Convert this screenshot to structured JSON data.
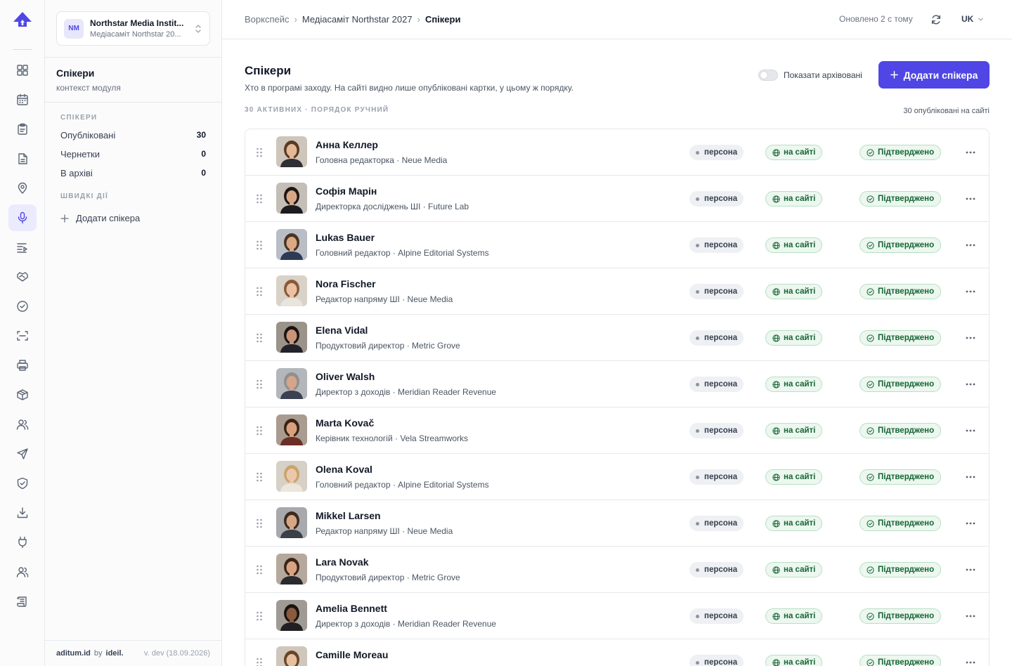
{
  "rail": {
    "icons": [
      "dashboard-icon",
      "calendar-icon",
      "clipboard-icon",
      "document-icon",
      "location-icon",
      "microphone-icon",
      "agenda-icon",
      "handshake-icon",
      "check-circle-icon",
      "scan-icon",
      "printer-icon",
      "package-icon",
      "users-icon",
      "send-icon",
      "shield-icon",
      "download-icon",
      "plug-icon",
      "team-icon",
      "scroll-icon"
    ],
    "active": "microphone-icon"
  },
  "workspace": {
    "badge": "NM",
    "name": "Northstar Media Instit...",
    "sub": "Медіасаміт Northstar 20..."
  },
  "module": {
    "title": "Спікери",
    "sub": "контекст модуля"
  },
  "sidebar": {
    "section_speakers": "СПІКЕРИ",
    "items": [
      {
        "label": "Опубліковані",
        "count": "30"
      },
      {
        "label": "Чернетки",
        "count": "0"
      },
      {
        "label": "В архіві",
        "count": "0"
      }
    ],
    "section_quick": "ШВИДКІ ДІЇ",
    "quick_add": "Додати спікера"
  },
  "footer": {
    "brand": "aditum.id",
    "by": "by",
    "maker": "ideil.",
    "version": "v. dev (18.09.2026)"
  },
  "breadcrumb": {
    "root": "Воркспейс",
    "event": "Медіасаміт Northstar 2027",
    "current": "Спікери"
  },
  "topbar": {
    "updated": "Оновлено 2 с тому",
    "lang": "UK"
  },
  "page": {
    "title": "Спікери",
    "subtitle": "Хто в програмі заходу. На сайті видно лише опубліковані картки, у цьому ж порядку.",
    "show_archived": "Показати архівовані",
    "add_button": "Додати спікера",
    "list_label": "30 АКТИВНИХ · ПОРЯДОК РУЧНИЙ",
    "published_count": "30 опубліковані на сайті"
  },
  "chips": {
    "type": "персона",
    "site": "на сайті",
    "status": "Підтверджено"
  },
  "colors": {
    "accent": "#4f46e5",
    "success": "#166534"
  },
  "speakers": [
    {
      "name": "Анна Келлер",
      "role": "Головна редакторка · Neue Media",
      "skin": "#e2b896",
      "hair": "#5a3a22",
      "shirt": "#2f2f35",
      "bg": "#cfc6bb"
    },
    {
      "name": "Софія Марін",
      "role": "Директорка досліджень ШІ · Future Lab",
      "skin": "#d8a886",
      "hair": "#1e1612",
      "shirt": "#1c1c20",
      "bg": "#c4beb6"
    },
    {
      "name": "Lukas Bauer",
      "role": "Головний редактор · Alpine Editorial Systems",
      "skin": "#d9a884",
      "hair": "#4a3322",
      "shirt": "#2c3b55",
      "bg": "#b9bec6"
    },
    {
      "name": "Nora Fischer",
      "role": "Редактор напряму ШІ · Neue Media",
      "skin": "#eac2a3",
      "hair": "#8a5a38",
      "shirt": "#e9e4dc",
      "bg": "#d8d2c8"
    },
    {
      "name": "Elena Vidal",
      "role": "Продуктовий директор · Metric Grove",
      "skin": "#c99577",
      "hair": "#1a1310",
      "shirt": "#22222a",
      "bg": "#9b928a"
    },
    {
      "name": "Oliver Walsh",
      "role": "Директор з доходів · Meridian Reader Revenue",
      "skin": "#d4a58a",
      "hair": "#8f8f8f",
      "shirt": "#3b4150",
      "bg": "#b3b6bb"
    },
    {
      "name": "Marta Kovač",
      "role": "Керівник технологій · Vela Streamworks",
      "skin": "#d9a07e",
      "hair": "#3a2216",
      "shirt": "#6b2e24",
      "bg": "#a99b8f"
    },
    {
      "name": "Olena Koval",
      "role": "Головний редактор · Alpine Editorial Systems",
      "skin": "#ecc7aa",
      "hair": "#c9a46b",
      "shirt": "#ece6dc",
      "bg": "#d6d0c6"
    },
    {
      "name": "Mikkel Larsen",
      "role": "Редактор напряму ШІ · Neue Media",
      "skin": "#d6a686",
      "hair": "#3b2a1e",
      "shirt": "#3a3f48",
      "bg": "#a7a9ad"
    },
    {
      "name": "Lara Novak",
      "role": "Продуктовий директор · Metric Grove",
      "skin": "#d8a382",
      "hair": "#3c2418",
      "shirt": "#2a2a30",
      "bg": "#b5a99d"
    },
    {
      "name": "Amelia Bennett",
      "role": "Директор з доходів · Meridian Reader Revenue",
      "skin": "#8a5a3e",
      "hair": "#1a120e",
      "shirt": "#1f1f24",
      "bg": "#a09a94"
    },
    {
      "name": "Camille Moreau",
      "role": "",
      "skin": "#e6bf9f",
      "hair": "#6b4428",
      "shirt": "#2a2a30",
      "bg": "#cfc7bc"
    }
  ]
}
